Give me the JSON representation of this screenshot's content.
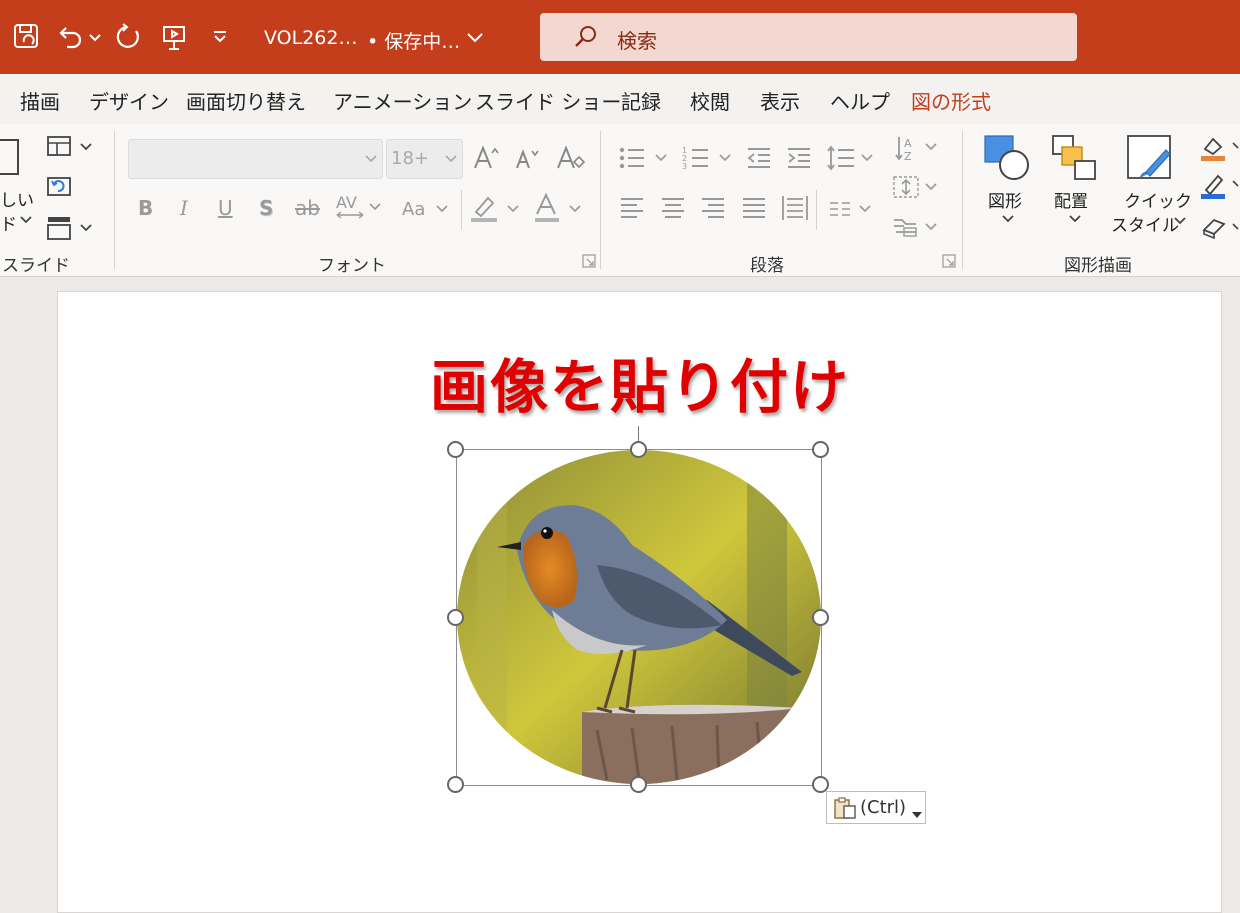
{
  "titlebar": {
    "filename": "VOL262…",
    "save_status": "• 保存中…",
    "search_placeholder": "検索"
  },
  "tabs": [
    {
      "label": "描画"
    },
    {
      "label": "デザイン"
    },
    {
      "label": "画面切り替え"
    },
    {
      "label": "アニメーション"
    },
    {
      "label": "スライド ショー"
    },
    {
      "label": "記録"
    },
    {
      "label": "校閲"
    },
    {
      "label": "表示"
    },
    {
      "label": "ヘルプ"
    },
    {
      "label": "図の形式",
      "active": true
    }
  ],
  "ribbon": {
    "slides_group": {
      "label": "スライド",
      "new_slide_line1": "しい",
      "new_slide_line2": "ド"
    },
    "font_group": {
      "label": "フォント",
      "font_size": "18+"
    },
    "paragraph_group": {
      "label": "段落"
    },
    "drawing_group": {
      "label": "図形描画",
      "shapes_label": "図形",
      "arrange_label": "配置",
      "quick_style_line1": "クイック",
      "quick_style_line2": "スタイル"
    }
  },
  "slide": {
    "title": "画像を貼り付け"
  },
  "paste_options": {
    "label": "(Ctrl)"
  },
  "colors": {
    "accent": "#c43e1c",
    "title_red": "#e00000"
  }
}
